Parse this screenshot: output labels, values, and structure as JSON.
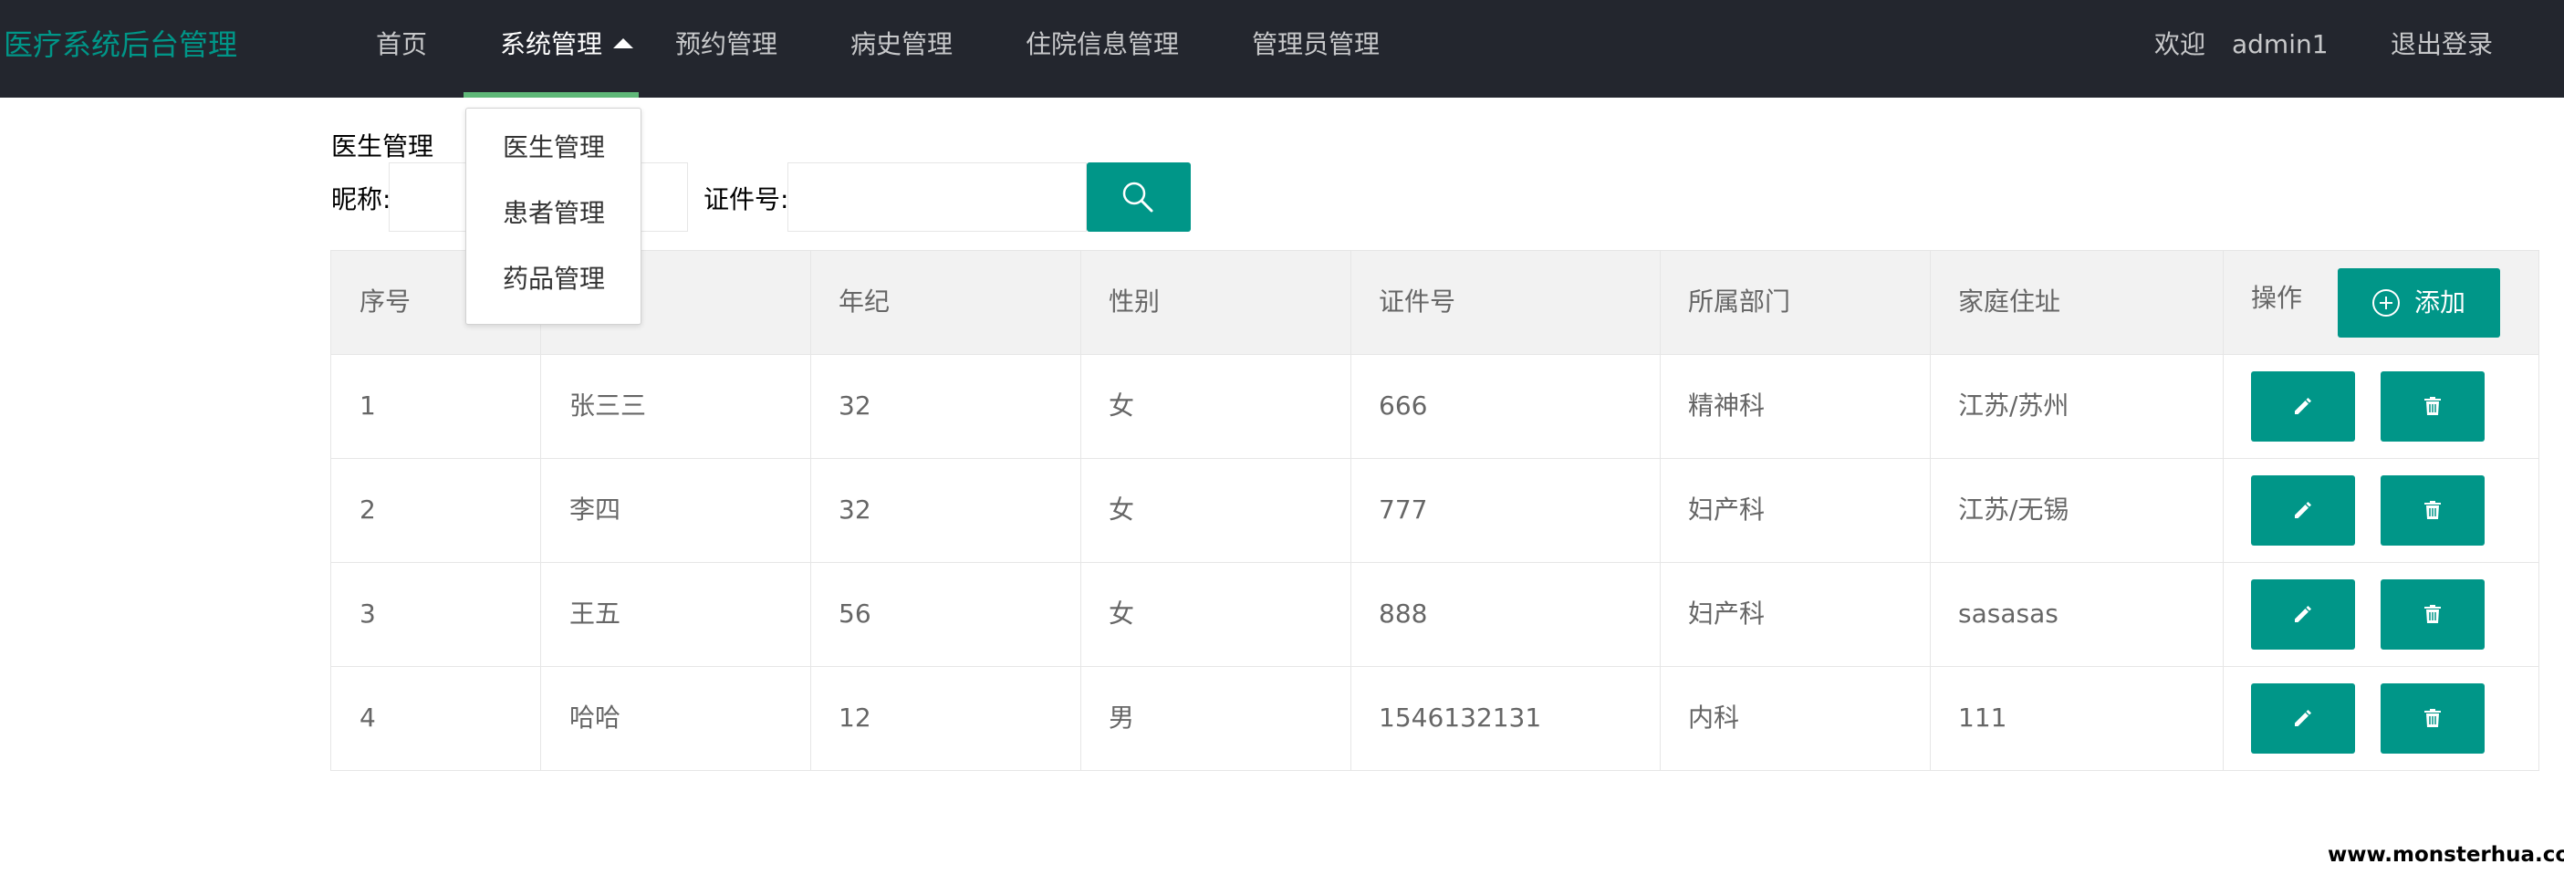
{
  "header": {
    "logo": "医疗系统后台管理",
    "nav": [
      "首页",
      "系统管理",
      "预约管理",
      "病史管理",
      "住院信息管理",
      "管理员管理"
    ],
    "welcome": "欢迎",
    "username": "admin1",
    "logout": "退出登录"
  },
  "dropdown": {
    "items": [
      "医生管理",
      "患者管理",
      "药品管理"
    ]
  },
  "filter": {
    "section_title": "医生管理",
    "nickname_label": "昵称:",
    "nickname_value": "",
    "id_label": "证件号:",
    "id_value": "",
    "search_icon": "search-icon"
  },
  "table": {
    "headers": [
      "序号",
      "",
      "年纪",
      "性别",
      "证件号",
      "所属部门",
      "家庭住址",
      "操作"
    ],
    "add_label": "添加",
    "rows": [
      [
        "1",
        "张三三",
        "32",
        "女",
        "666",
        "精神科",
        "江苏/苏州"
      ],
      [
        "2",
        "李四",
        "32",
        "女",
        "777",
        "妇产科",
        "江苏/无锡"
      ],
      [
        "3",
        "王五",
        "56",
        "女",
        "888",
        "妇产科",
        "sasasas"
      ],
      [
        "4",
        "哈哈",
        "12",
        "男",
        "1546132131",
        "内科",
        "111"
      ]
    ],
    "row_icons": [
      "edit-icon",
      "delete-icon"
    ]
  },
  "colors": {
    "header_bg": "#23262e",
    "accent": "#009688",
    "nav_active_underline": "#5fb878"
  },
  "watermark": "www.monsterhua.com"
}
